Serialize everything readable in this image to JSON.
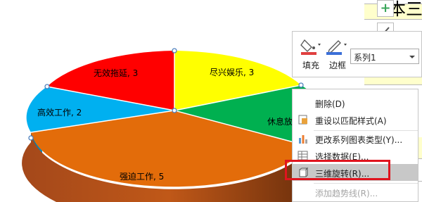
{
  "sheet": {
    "title_fragment": "本三"
  },
  "chart": {
    "slices": [
      {
        "label": "无效拖延",
        "value": 3,
        "color": "#ff0000"
      },
      {
        "label": "尽兴娱乐",
        "value": 3,
        "color": "#ffff00"
      },
      {
        "label": "休息放",
        "value": null,
        "color": "#00b050"
      },
      {
        "label": "强迫工作",
        "value": 5,
        "color": "#e36c0a"
      },
      {
        "label": "高效工作",
        "value": 2,
        "color": "#00b0f0"
      }
    ],
    "label_texts": {
      "wuxiao": "无效拖延, 3",
      "jinxing": "尽兴娱乐, 3",
      "xiuxi": "休息放",
      "qiangpo": "强迫工作, 5",
      "gaoxiao": "高效工作, 2"
    }
  },
  "mini_toolbar": {
    "fill_label": "填充",
    "border_label": "边框",
    "series_value": "系列1",
    "fill_color": "#e04040",
    "border_color": "#3b6fd8"
  },
  "context_menu": {
    "items": [
      {
        "label": "删除(D)",
        "icon": "delete-icon",
        "enabled": true
      },
      {
        "label": "重设以匹配样式(A)",
        "icon": "reset-style-icon",
        "enabled": true
      },
      {
        "label": "更改系列图表类型(Y)...",
        "icon": "chart-type-icon",
        "enabled": true
      },
      {
        "label": "选择数据(E)...",
        "icon": "select-data-icon",
        "enabled": true
      },
      {
        "label": "三维旋转(R)...",
        "icon": "rotate-3d-icon",
        "enabled": true,
        "selected": true
      },
      {
        "label": "添加趋势线(R)...",
        "icon": "trendline-icon",
        "enabled": false
      }
    ]
  }
}
